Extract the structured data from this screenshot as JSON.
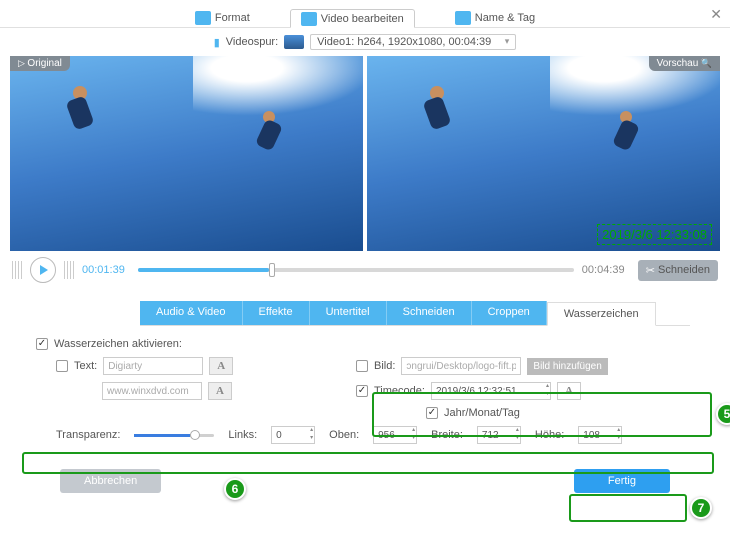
{
  "close_x": "✕",
  "top": {
    "format": "Format",
    "edit": "Video bearbeiten",
    "name": "Name & Tag"
  },
  "spur": {
    "label": "Videospur:",
    "sel": "Video1: h264, 1920x1080, 00:04:39"
  },
  "badges": {
    "orig": "Original",
    "vor": "Vorschau"
  },
  "timecode_overlay": "2019/3/6 12:33:08",
  "play": {
    "cur": "00:01:39",
    "dur": "00:04:39"
  },
  "cut": "Schneiden",
  "etabs": {
    "av": "Audio & Video",
    "fx": "Effekte",
    "sub": "Untertitel",
    "cut": "Schneiden",
    "crop": "Croppen",
    "wm": "Wasserzeichen"
  },
  "wm": {
    "enable": "Wasserzeichen aktivieren:",
    "text_lbl": "Text:",
    "text1": "Digiarty",
    "text2": "www.winxdvd.com",
    "img_lbl": "Bild:",
    "img_path": "ɔngrui/Desktop/logo-fift.png",
    "img_btn": "Bild hinzufügen",
    "tc_lbl": "Timecode:",
    "tc_val": "2019/3/6 12:32:51",
    "tc_fmt": "Jahr/Monat/Tag",
    "trans": "Transparenz:",
    "links": "Links:",
    "links_v": "0",
    "oben": "Oben:",
    "oben_v": "956",
    "breite": "Breite:",
    "breite_v": "712",
    "hoehe": "Höhe:",
    "hoehe_v": "108"
  },
  "btns": {
    "cancel": "Abbrechen",
    "done": "Fertig"
  },
  "nums": {
    "n5": "5",
    "n6": "6",
    "n7": "7"
  }
}
